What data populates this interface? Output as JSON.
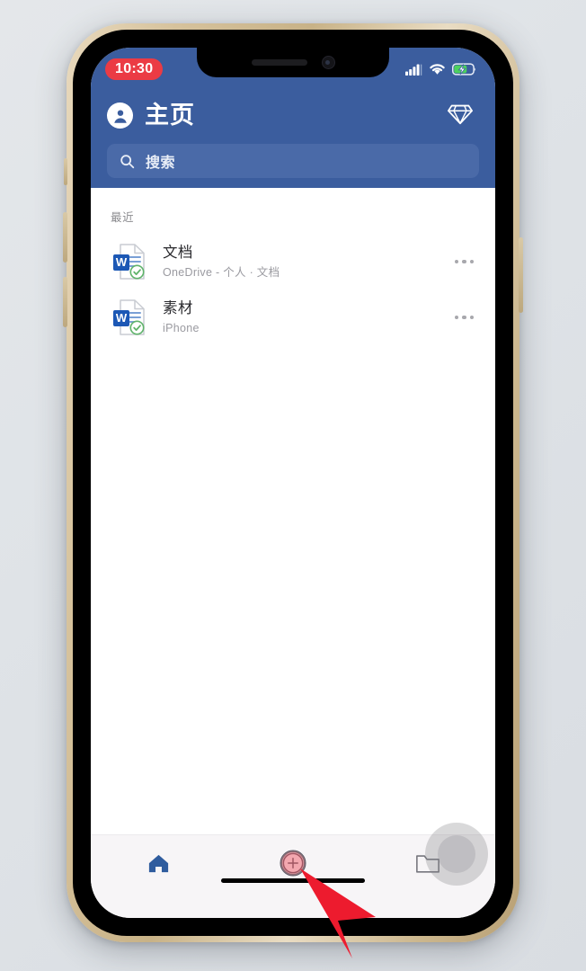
{
  "device": {
    "frame_color": "#c8b287",
    "screen_bg": "#ffffff"
  },
  "status_bar": {
    "time": "10:30",
    "time_pill_color": "#eb3b44",
    "icons": [
      "cellular-signal-icon",
      "wifi-icon",
      "battery-charging-icon"
    ],
    "battery_color": "#4cd25e"
  },
  "header": {
    "background": "#3b5d9e",
    "avatar_icon": "account-avatar-icon",
    "title": "主页",
    "premium_icon": "diamond-icon"
  },
  "search": {
    "placeholder": "搜索",
    "icon": "search-icon",
    "background": "#4a6aa8"
  },
  "content": {
    "section_label": "最近",
    "files": [
      {
        "title": "文档",
        "subtitle": "OneDrive - 个人 · 文档",
        "icon": "word-document-icon",
        "sync_state": "synced",
        "more_label": "•••"
      },
      {
        "title": "素材",
        "subtitle": "iPhone",
        "icon": "word-document-icon",
        "sync_state": "synced",
        "more_label": "•••"
      }
    ]
  },
  "tab_bar": {
    "background": "#f7f5f7",
    "items": [
      {
        "name": "home",
        "icon": "home-icon",
        "active": true,
        "active_color": "#2f5c9e"
      },
      {
        "name": "create",
        "icon": "plus-circle-icon",
        "active": false
      },
      {
        "name": "files",
        "icon": "folder-icon",
        "active": false
      }
    ]
  },
  "overlays": {
    "tap_highlight_color": "#ed283a",
    "cursor_color": "#ed1b2e",
    "assistive_touch_icon": "assistive-touch-button"
  }
}
